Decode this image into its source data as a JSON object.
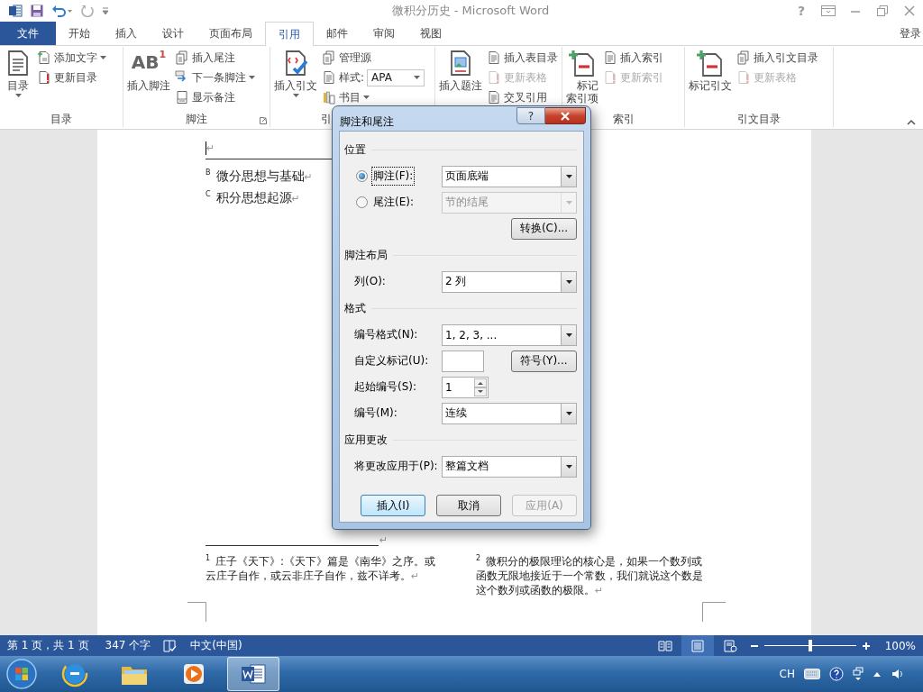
{
  "window": {
    "title": "微积分历史 - Microsoft Word",
    "help": "?"
  },
  "tabs": [
    {
      "label": "文件",
      "kind": "file",
      "selected": false
    },
    {
      "label": "开始",
      "kind": "tab",
      "selected": false
    },
    {
      "label": "插入",
      "kind": "tab",
      "selected": false
    },
    {
      "label": "设计",
      "kind": "tab",
      "selected": false
    },
    {
      "label": "页面布局",
      "kind": "tab",
      "selected": false
    },
    {
      "label": "引用",
      "kind": "tab",
      "selected": true
    },
    {
      "label": "邮件",
      "kind": "tab",
      "selected": false
    },
    {
      "label": "审阅",
      "kind": "tab",
      "selected": false
    },
    {
      "label": "视图",
      "kind": "tab",
      "selected": false
    }
  ],
  "account": "登录",
  "ribbon": {
    "groups": [
      {
        "label": "目录",
        "items": [
          {
            "kind": "large",
            "label": "目录",
            "dropdown": true,
            "disabled": false
          },
          {
            "kind": "small",
            "label": "添加文字",
            "dropdown": true,
            "disabled": false
          },
          {
            "kind": "small",
            "label": "更新目录",
            "disabled": false
          }
        ]
      },
      {
        "label": "脚注",
        "launcher": true,
        "items": [
          {
            "kind": "large",
            "label": "插入脚注",
            "glyph": "AB",
            "sup": "1",
            "disabled": false
          },
          {
            "kind": "small",
            "label": "插入尾注",
            "disabled": false
          },
          {
            "kind": "small",
            "label": "下一条脚注",
            "dropdown": true,
            "disabled": false
          },
          {
            "kind": "small",
            "label": "显示备注",
            "disabled": false
          }
        ]
      },
      {
        "label": "引",
        "items": [
          {
            "kind": "large",
            "label": "插入引文",
            "dropdown": true,
            "disabled": false
          },
          {
            "kind": "small",
            "label": "管理源",
            "disabled": false
          },
          {
            "kind": "select",
            "label": "样式:",
            "value": "APA",
            "disabled": false
          },
          {
            "kind": "small",
            "label": "书目",
            "dropdown": true,
            "disabled": false
          }
        ]
      },
      {
        "items": [
          {
            "kind": "large",
            "label": "插入题注",
            "disabled": false
          },
          {
            "kind": "small",
            "label": "插入表目录",
            "disabled": false
          },
          {
            "kind": "small",
            "label": "更新表格",
            "disabled": true
          },
          {
            "kind": "small",
            "label": "交叉引用",
            "disabled": false
          }
        ]
      },
      {
        "label": "索引",
        "items": [
          {
            "kind": "large",
            "label": "标记索引项",
            "disabled": false
          },
          {
            "kind": "small",
            "label": "插入索引",
            "disabled": false
          },
          {
            "kind": "small",
            "label": "更新索引",
            "disabled": true
          }
        ]
      },
      {
        "label": "引文目录",
        "items": [
          {
            "kind": "large",
            "label": "标记引文",
            "disabled": false
          },
          {
            "kind": "small",
            "label": "插入引文目录",
            "disabled": false
          },
          {
            "kind": "small",
            "label": "更新表格",
            "disabled": true
          }
        ]
      }
    ]
  },
  "document": {
    "cursor_mark": "↵",
    "endnotes": [
      {
        "ref": "B",
        "text": "微分思想与基础",
        "mark": "↵"
      },
      {
        "ref": "C",
        "text": "积分思想起源",
        "mark": "↵"
      }
    ],
    "separator_mark": "↵",
    "footnotes": [
      {
        "ref": "1",
        "text": "庄子《天下》:《天下》篇是《南华》之序。或云庄子自作，或云非庄子自作，兹不详考。",
        "mark": "↵"
      },
      {
        "ref": "2",
        "text": "微积分的极限理论的核心是，如果一个数列或函数无限地接近于一个常数，我们就说这个数是这个数列或函数的极限。",
        "mark": "↵"
      }
    ]
  },
  "dialog": {
    "title": "脚注和尾注",
    "help": "?",
    "sections": [
      {
        "heading": "位置",
        "rows": [
          {
            "kind": "radio_select",
            "label": "脚注(F):",
            "selected": true,
            "focused": true,
            "value": "页面底端",
            "disabled": false
          },
          {
            "kind": "radio_select",
            "label": "尾注(E):",
            "selected": false,
            "focused": false,
            "value": "节的结尾",
            "disabled": true
          },
          {
            "kind": "button",
            "button": "转换(C)..."
          }
        ]
      },
      {
        "heading": "脚注布局",
        "rows": [
          {
            "kind": "select",
            "label": "列(O):",
            "value": "2 列",
            "disabled": false
          }
        ]
      },
      {
        "heading": "格式",
        "rows": [
          {
            "kind": "select",
            "label": "编号格式(N):",
            "value": "1, 2, 3, ...",
            "disabled": false
          },
          {
            "kind": "input_button",
            "label": "自定义标记(U):",
            "button": "符号(Y)..."
          },
          {
            "kind": "spinner",
            "label": "起始编号(S):",
            "value": "1"
          },
          {
            "kind": "select",
            "label": "编号(M):",
            "value": "连续",
            "disabled": false
          }
        ]
      },
      {
        "heading": "应用更改",
        "rows": [
          {
            "kind": "select",
            "label": "将更改应用于(P):",
            "value": "整篇文档",
            "disabled": false
          }
        ]
      }
    ],
    "buttons": [
      {
        "label": "插入(I)",
        "default": true,
        "disabled": false
      },
      {
        "label": "取消",
        "default": false,
        "disabled": false
      },
      {
        "label": "应用(A)",
        "default": false,
        "disabled": true
      }
    ]
  },
  "status_bar": {
    "page": "第 1 页，共 1 页",
    "words": "347 个字",
    "language": "中文(中国)",
    "views": [
      {
        "selected": false
      },
      {
        "selected": true
      },
      {
        "selected": false
      }
    ],
    "zoom": {
      "level": 0.5,
      "reading": "100%"
    }
  },
  "taskbar": {
    "apps": [
      {
        "selected": false
      },
      {
        "selected": false
      },
      {
        "selected": false
      },
      {
        "selected": true
      }
    ],
    "tray": {
      "language": "CH"
    }
  }
}
